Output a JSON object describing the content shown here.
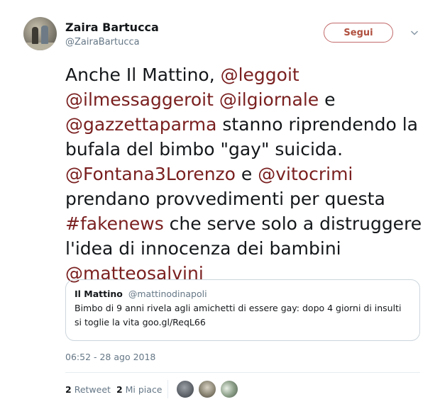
{
  "author": {
    "name": "Zaira Bartucca",
    "handle": "@ZairaBartucca",
    "avatar_icon": "profile-photo"
  },
  "follow_button": {
    "label": "Segui"
  },
  "menu": {
    "icon": "chevron-down-icon"
  },
  "tweet": {
    "segments": [
      {
        "text": "Anche Il Mattino, ",
        "type": "text"
      },
      {
        "text": "@leggoit",
        "type": "link"
      },
      {
        "text": " ",
        "type": "text"
      },
      {
        "text": "@ilmessaggeroit",
        "type": "link"
      },
      {
        "text": " ",
        "type": "text"
      },
      {
        "text": "@ilgiornale",
        "type": "link"
      },
      {
        "text": " e ",
        "type": "text"
      },
      {
        "text": "@gazzettaparma",
        "type": "link"
      },
      {
        "text": " stanno riprendendo la bufala del bimbo \"gay\" suicida. ",
        "type": "text"
      },
      {
        "text": "@Fontana3Lorenzo",
        "type": "link"
      },
      {
        "text": " e ",
        "type": "text"
      },
      {
        "text": "@vitocrimi",
        "type": "link"
      },
      {
        "text": " prendano provvedimenti per questa ",
        "type": "text"
      },
      {
        "text": "#fakenews",
        "type": "link"
      },
      {
        "text": " che serve solo a distruggere l'idea di innocenza dei bambini ",
        "type": "text"
      },
      {
        "text": "@matteosalvini",
        "type": "link"
      }
    ]
  },
  "quoted_tweet": {
    "name": "Il Mattino",
    "handle": "@mattinodinapoli",
    "text": "Bimbo di 9 anni rivela agli amichetti di essere gay: dopo 4 giorni di insulti si toglie la vita goo.gl/ReqL66"
  },
  "timestamp": "06:52 - 28 ago 2018",
  "stats": {
    "retweets_count": "2",
    "retweets_label": "Retweet",
    "likes_count": "2",
    "likes_label": "Mi piace"
  },
  "colors": {
    "link": "#7a1f1f",
    "follow_border": "#c26a6a",
    "follow_text": "#b0503f",
    "muted": "#657786"
  }
}
